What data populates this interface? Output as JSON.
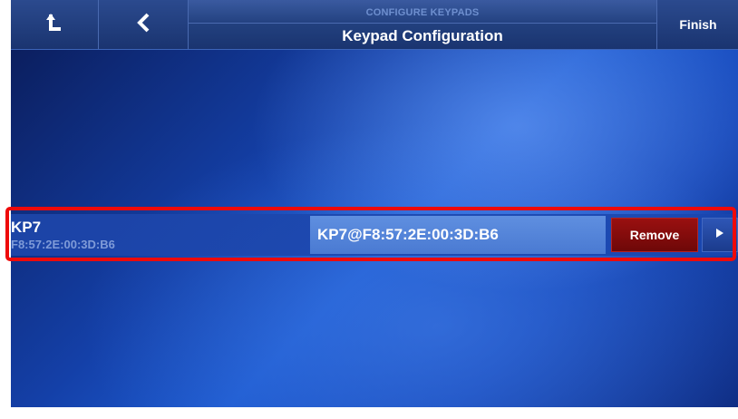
{
  "header": {
    "home_icon": "home-arrow-up-icon",
    "back_icon": "chevron-left-icon",
    "subtitle": "CONFIGURE KEYPADS",
    "title": "Keypad Configuration",
    "finish_label": "Finish"
  },
  "keypads": [
    {
      "name": "KP7",
      "mac": "F8:57:2E:00:3D:B6",
      "field_value": "KP7@F8:57:2E:00:3D:B6",
      "remove_label": "Remove",
      "next_icon": "play-triangle-icon"
    }
  ],
  "colors": {
    "highlight": "#ee0a0a",
    "remove": "#8a0c0c",
    "field": "#5585dc",
    "background": "#1a4cc0"
  }
}
